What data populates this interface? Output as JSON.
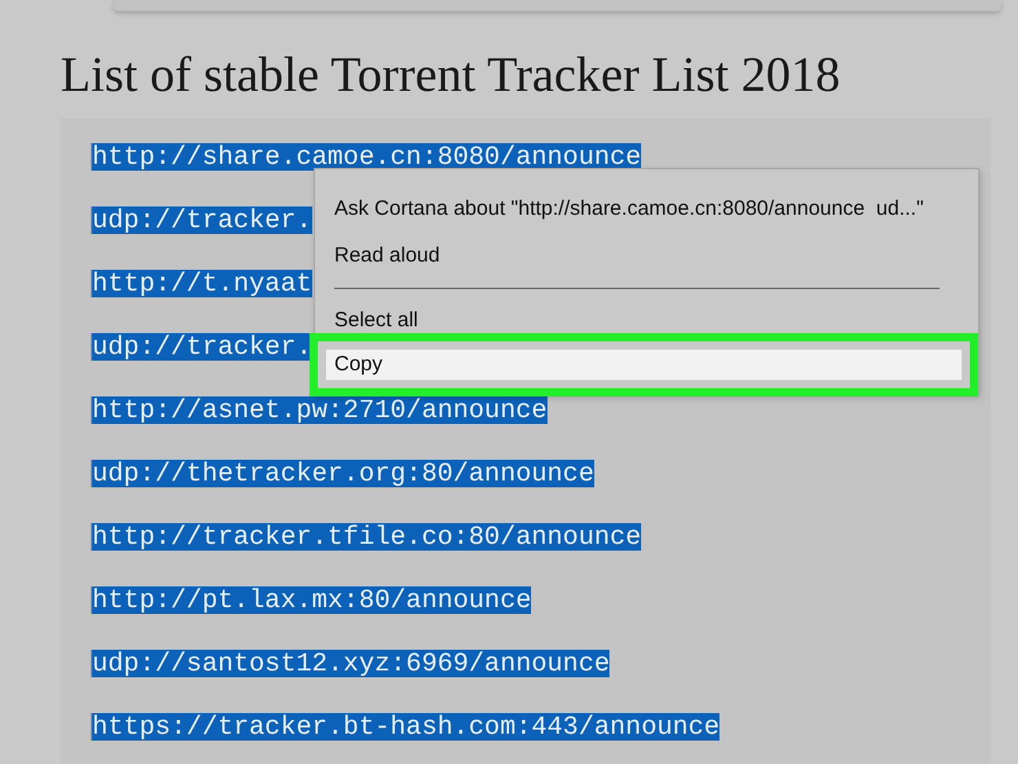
{
  "heading": "List of stable Torrent Tracker List 2018",
  "trackers": [
    {
      "text": "http://share.camoe.cn:8080/announce",
      "selected": true
    },
    {
      "text": "udp://tracker.",
      "selected": true
    },
    {
      "text": "http://t.nyaat",
      "selected": true
    },
    {
      "text": "udp://tracker.",
      "selected": true
    },
    {
      "text": "http://asnet.pw:2710/announce",
      "selected": true
    },
    {
      "text": "udp://thetracker.org:80/announce",
      "selected": true
    },
    {
      "text": "http://tracker.tfile.co:80/announce",
      "selected": true
    },
    {
      "text": "http://pt.lax.mx:80/announce",
      "selected": true
    },
    {
      "text": "udp://santost12.xyz:6969/announce",
      "selected": true
    },
    {
      "text": "https://tracker.bt-hash.com:443/announce",
      "selected": true
    }
  ],
  "context_menu": [
    {
      "kind": "item",
      "label": "Ask Cortana about \"http://share.camoe.cn:8080/announce  ud...\"",
      "selected": false
    },
    {
      "kind": "item",
      "label": "Read aloud",
      "selected": false
    },
    {
      "kind": "separator"
    },
    {
      "kind": "item",
      "label": "Select all",
      "selected": false
    },
    {
      "kind": "item",
      "label": "Copy",
      "selected": true
    }
  ]
}
